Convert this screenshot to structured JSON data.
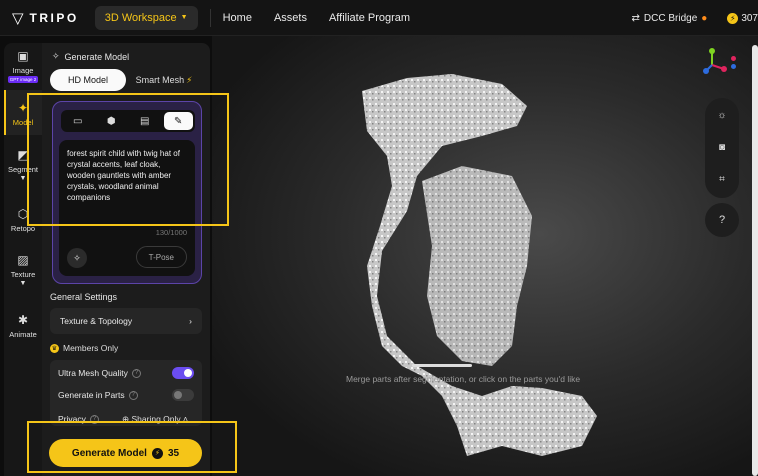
{
  "topbar": {
    "brand": "TRIPO",
    "workspace": "3D Workspace",
    "nav": [
      "Home",
      "Assets",
      "Affiliate Program"
    ],
    "dcc": "DCC Bridge",
    "credits": "307"
  },
  "rail": {
    "items": [
      {
        "label": "Image",
        "badge": "GPT image 2"
      },
      {
        "label": "Model"
      },
      {
        "label": "Segment"
      },
      {
        "label": "Retopo"
      },
      {
        "label": "Texture"
      },
      {
        "label": "Animate"
      }
    ]
  },
  "panel": {
    "title": "Generate Model",
    "tabs": [
      "HD Model",
      "Smart Mesh"
    ],
    "prompt": "forest spirit child with twig hat of crystal accents, leaf cloak, wooden gauntlets with amber crystals, woodland animal companions",
    "counter": "130/1000",
    "tpose": "T-Pose",
    "general_settings": "General Settings",
    "texture_topology": "Texture & Topology",
    "members_only": "Members Only",
    "options": [
      {
        "label": "Ultra Mesh Quality",
        "on": true
      },
      {
        "label": "Generate in Parts",
        "on": false
      }
    ],
    "privacy": {
      "label": "Privacy",
      "value": "Sharing Only"
    },
    "generate": {
      "label": "Generate Model",
      "cost": "35"
    }
  },
  "canvas": {
    "hint": "Merge parts after segmentation, or click on the parts you'd like"
  },
  "colors": {
    "accent": "#f5c518",
    "purple": "#6b4df0"
  }
}
